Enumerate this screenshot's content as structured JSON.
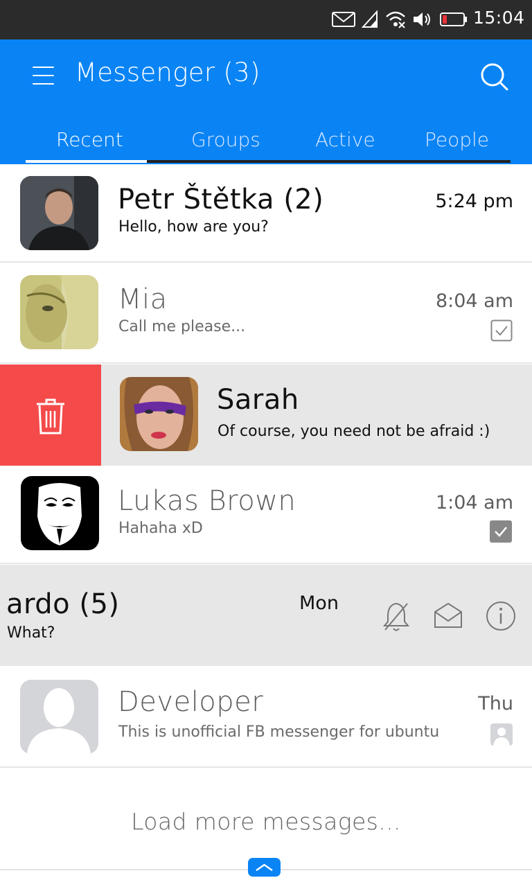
{
  "status_bar": {
    "time": "15:04"
  },
  "header": {
    "title": "Messenger (3)",
    "tabs": [
      {
        "label": "Recent",
        "active": true
      },
      {
        "label": "Groups",
        "active": false
      },
      {
        "label": "Active",
        "active": false
      },
      {
        "label": "People",
        "active": false
      }
    ]
  },
  "conversations": [
    {
      "name": "Petr Štětka (2)",
      "message": "Hello, how are you?",
      "time": "5:24 pm",
      "unread": true
    },
    {
      "name": "Mia",
      "message": "Call me please...",
      "time": "8:04 am",
      "status_icon": "check-icon"
    },
    {
      "name": "Sarah",
      "message": "Of course, you need not be afraid :)",
      "swiped": "delete"
    },
    {
      "name": "Lukas Brown",
      "message": "Hahaha xD",
      "time": "1:04 am",
      "status_icon": "check-filled-icon"
    },
    {
      "name": "ardo (5)",
      "message": "What?",
      "time": "Mon",
      "unread": true,
      "actions": [
        "mute-icon",
        "mark-read-icon",
        "info-icon"
      ]
    },
    {
      "name": "Developer",
      "message": "This is unofficial FB messenger for ubuntu",
      "time": "Thu",
      "status_icon": "person-icon"
    }
  ],
  "load_more": "Load more messages...",
  "colors": {
    "accent": "#0a84f5",
    "delete": "#f44a4a",
    "statusbar": "#2b2b2b"
  }
}
